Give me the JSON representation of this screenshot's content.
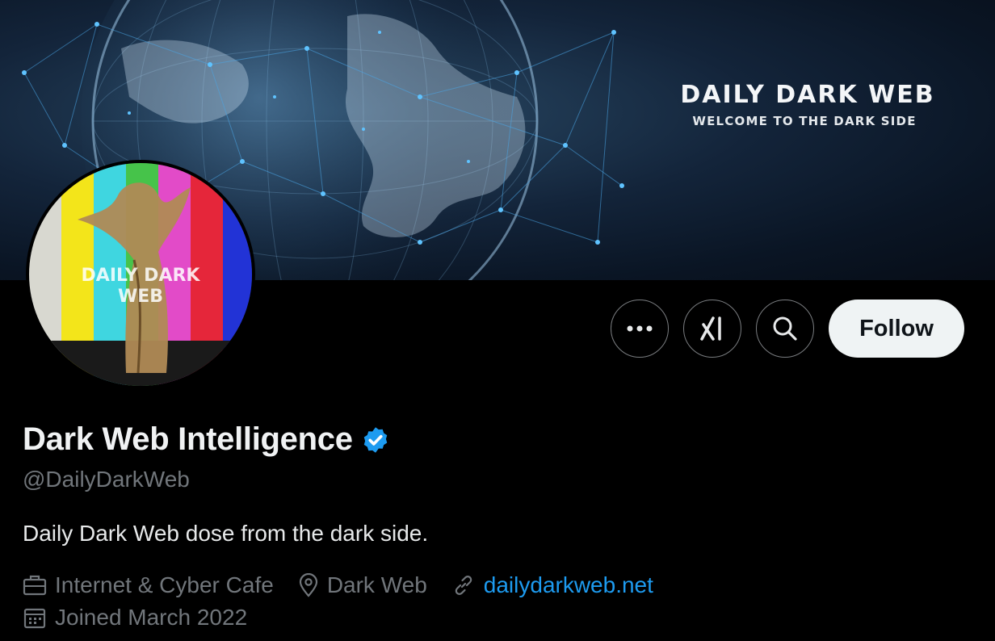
{
  "banner": {
    "title": "DAILY DARK WEB",
    "subtitle": "WELCOME TO THE DARK SIDE"
  },
  "avatar": {
    "text_line1": "DAILY DARK",
    "text_line2": "WEB"
  },
  "actions": {
    "more_icon": "more-horizontal-icon",
    "grok_icon": "grok-icon",
    "search_icon": "search-icon",
    "follow_label": "Follow"
  },
  "profile": {
    "display_name": "Dark Web Intelligence",
    "handle": "@DailyDarkWeb",
    "bio": "Daily Dark Web dose from the dark side.",
    "category": "Internet & Cyber Cafe",
    "location": "Dark Web",
    "website": "dailydarkweb.net",
    "joined": "Joined March 2022"
  },
  "colors": {
    "accent": "#1d9bf0",
    "background": "#000000",
    "muted": "#71767b",
    "follow_bg": "#eff3f4"
  }
}
